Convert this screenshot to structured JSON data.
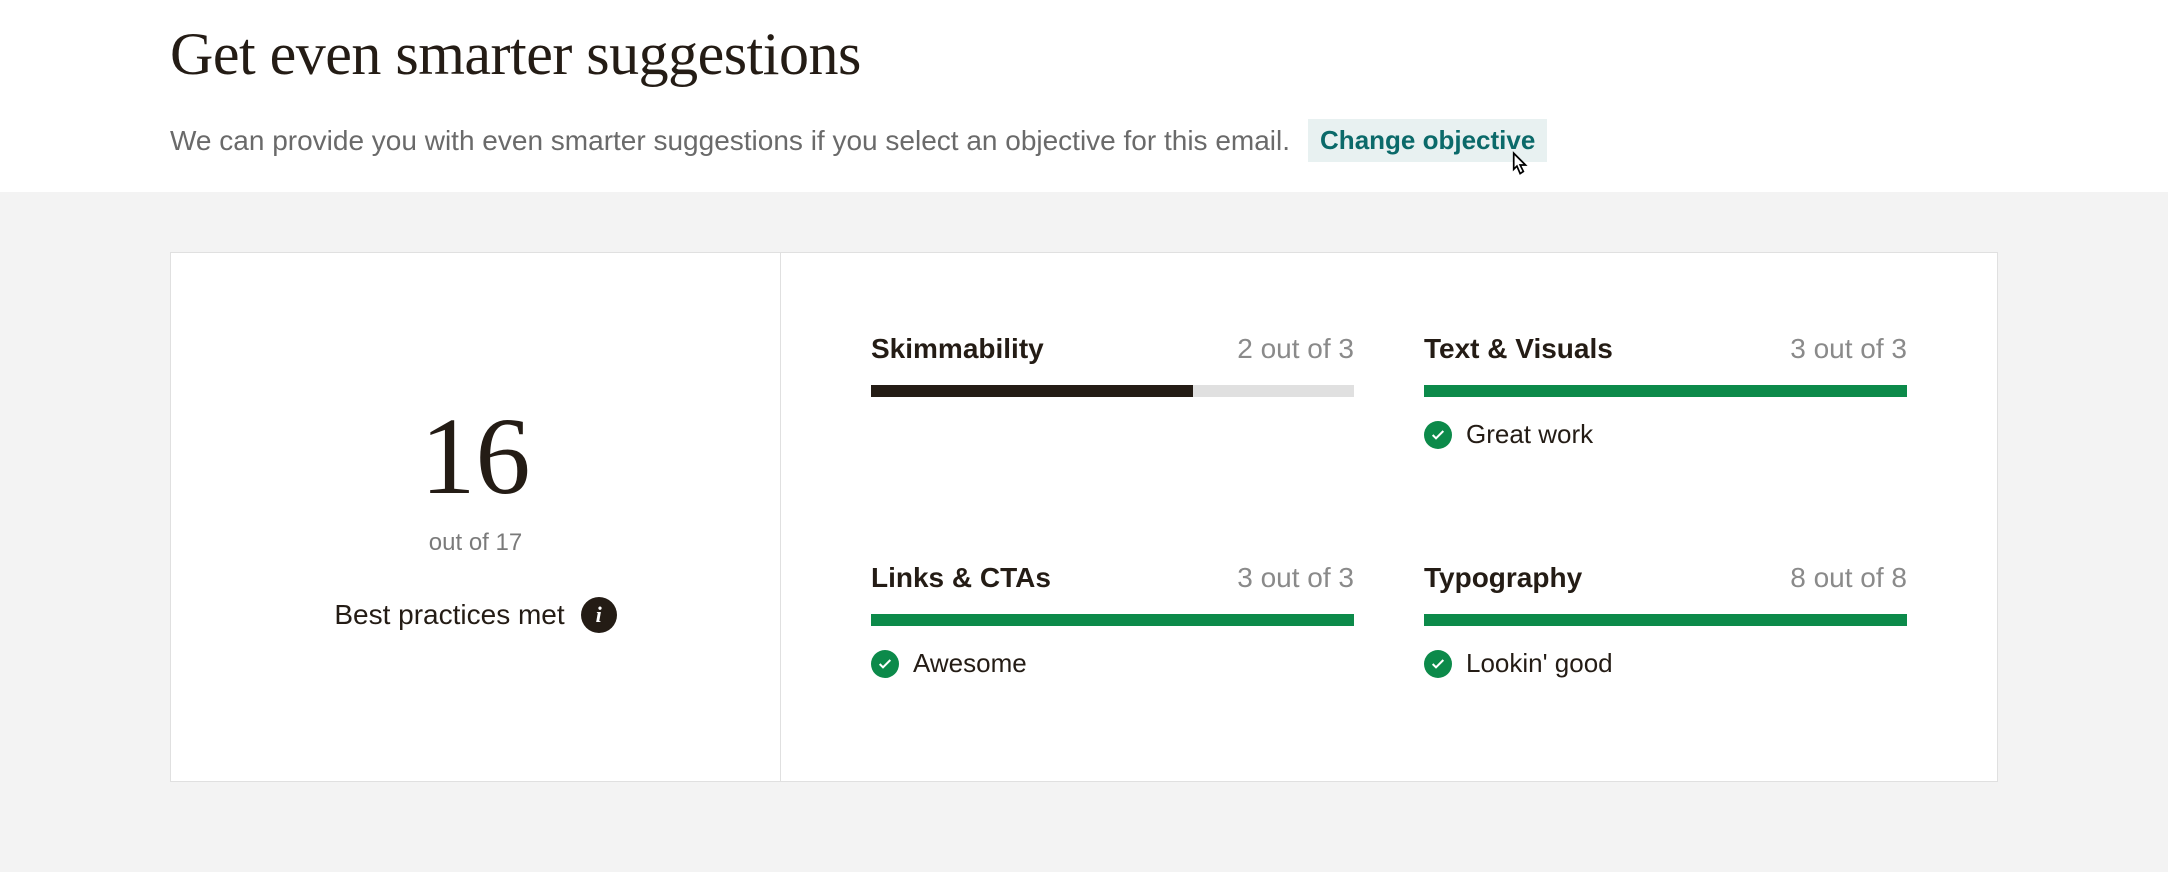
{
  "header": {
    "title": "Get even smarter suggestions",
    "subtitle": "We can provide you with even smarter suggestions if you select an objective for this email.",
    "change_link": "Change objective"
  },
  "summary": {
    "score": "16",
    "out_of": "out of 17",
    "label": "Best practices met"
  },
  "metrics": [
    {
      "name": "Skimmability",
      "score_text": "2 out of 3",
      "fill_pct": 66.7,
      "color": "black",
      "message": ""
    },
    {
      "name": "Text & Visuals",
      "score_text": "3 out of 3",
      "fill_pct": 100,
      "color": "green",
      "message": "Great work"
    },
    {
      "name": "Links & CTAs",
      "score_text": "3 out of 3",
      "fill_pct": 100,
      "color": "green",
      "message": "Awesome"
    },
    {
      "name": "Typography",
      "score_text": "8 out of 8",
      "fill_pct": 100,
      "color": "green",
      "message": "Lookin' good"
    }
  ],
  "chart_data": {
    "type": "bar",
    "title": "Best practices met",
    "categories": [
      "Skimmability",
      "Text & Visuals",
      "Links & CTAs",
      "Typography"
    ],
    "values": [
      2,
      3,
      3,
      8
    ],
    "max_values": [
      3,
      3,
      3,
      8
    ],
    "total": 16,
    "total_max": 17
  }
}
